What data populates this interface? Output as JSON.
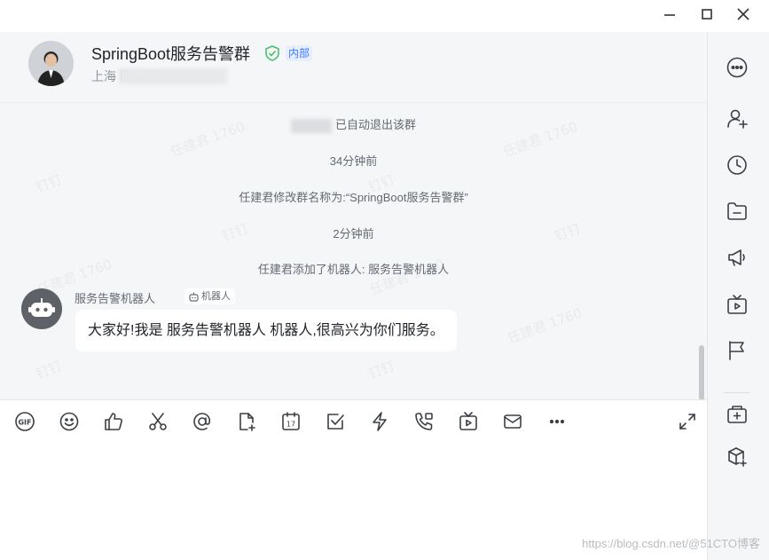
{
  "header": {
    "group_name": "SpringBoot服务告警群",
    "internal_tag": "内部",
    "company": "上海                    限公司"
  },
  "messages": {
    "sys1": "已自动退出该群",
    "time1": "34分钟前",
    "sys2": "任建君修改群名称为:“SpringBoot服务告警群”",
    "time2": "2分钟前",
    "sys3": "任建君添加了机器人: 服务告警机器人",
    "bot_name": "服务告警机器人",
    "bot_tag": "机器人",
    "bot_text": "大家好!我是 服务告警机器人 机器人,很高兴为你们服务。"
  },
  "watermarks": [
    "任建君 1760",
    "钉钉"
  ],
  "footer_watermark": "https://blog.csdn.net/@51CTO博客",
  "colors": {
    "accent": "#3a7afe",
    "verified": "#3fbf6a",
    "bot_avatar": "#5e6167"
  },
  "toolbar_icons": [
    "gif-icon",
    "emoji-icon",
    "thumbs-up-icon",
    "scissors-icon",
    "at-icon",
    "file-add-icon",
    "calendar-icon",
    "task-icon",
    "lightning-icon",
    "phone-icon",
    "live-icon",
    "mail-icon",
    "more-icon",
    "expand-icon"
  ],
  "sidebar_icons": [
    "more-icon",
    "add-member-icon",
    "history-icon",
    "folder-icon",
    "announcement-icon",
    "live-tv-icon",
    "flag-icon",
    "add-app-icon",
    "plugin-icon"
  ]
}
